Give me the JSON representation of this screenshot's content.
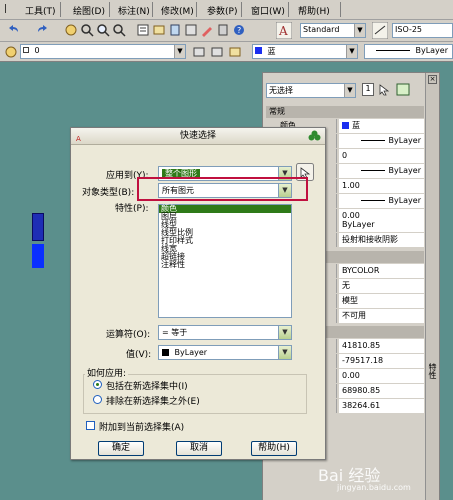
{
  "menubar": {
    "items": [
      "工具(T)",
      "绘图(D)",
      "标注(N)",
      "修改(M)",
      "参数(P)",
      "窗口(W)",
      "帮助(H)"
    ]
  },
  "toolbar": {
    "text_style": "Standard",
    "dim_style": "ISO-25",
    "layer_value": "0",
    "color_value": "蓝",
    "linetype_value": "ByLayer"
  },
  "properties_palette": {
    "selection": "无选择",
    "side_label": "特性",
    "sections": {
      "general": "常规",
      "rows": [
        {
          "key": "颜色",
          "value": "蓝"
        },
        {
          "key": "",
          "value": "ByLayer"
        },
        {
          "key": "",
          "value": "0"
        },
        {
          "key": "",
          "value": "ByLayer"
        },
        {
          "key": "",
          "value": "1.00"
        },
        {
          "key": "",
          "value": "ByLayer"
        },
        {
          "key": "",
          "value": "0.00"
        }
      ],
      "rows2": [
        {
          "key": "",
          "value": "ByLayer"
        },
        {
          "key": "",
          "value": "投射和接收阴影"
        }
      ],
      "rows3": [
        {
          "key": "",
          "value": "BYCOLOR"
        },
        {
          "key": "柔",
          "value": "无"
        },
        {
          "key": "",
          "value": "模型"
        },
        {
          "key": "",
          "value": "不可用"
        }
      ],
      "rows4": [
        {
          "key": "标",
          "value": "41810.85"
        },
        {
          "key": "标",
          "value": "-79517.18"
        },
        {
          "key": "",
          "value": "0.00"
        },
        {
          "key": "",
          "value": "68980.85"
        },
        {
          "key": "",
          "value": "38264.61"
        }
      ]
    }
  },
  "dialog": {
    "title": "快速选择",
    "apply_to_label": "应用到(Y):",
    "apply_to_value": "整个图形",
    "object_type_label": "对象类型(B):",
    "object_type_value": "所有图元",
    "properties_label": "特性(P):",
    "properties_list": [
      "颜色",
      "图层",
      "线型",
      "线型比例",
      "打印样式",
      "线宽",
      "超链接",
      "注释性"
    ],
    "operator_label": "运算符(O):",
    "operator_value": "= 等于",
    "value_label": "值(V):",
    "value_value": "ByLayer",
    "how_to_apply_label": "如何应用:",
    "radio_include": "包括在新选择集中(I)",
    "radio_exclude": "排除在新选择集之外(E)",
    "append_label": "附加到当前选择集(A)",
    "ok_button": "确定",
    "cancel_button": "取消",
    "help_button": "帮助(H)"
  },
  "watermark": {
    "text": "Bai 经验",
    "sub": "jingyan.baidu.com"
  },
  "colors": {
    "canvas": "#5b8f8c",
    "highlight_red": "#c0103f",
    "selection_green": "#2f7a18"
  }
}
